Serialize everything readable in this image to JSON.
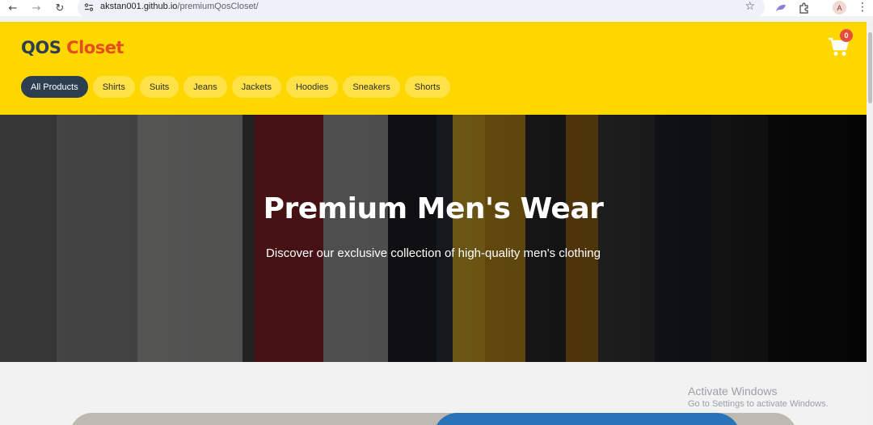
{
  "browser": {
    "url_host": "akstan001.github.io",
    "url_path": "/premiumQosCloset/",
    "profile_initial": "A"
  },
  "header": {
    "logo_part1": "QOS",
    "logo_part2": "Closet",
    "cart_count": "0"
  },
  "categories": [
    {
      "label": "All Products",
      "active": true
    },
    {
      "label": "Shirts"
    },
    {
      "label": "Suits"
    },
    {
      "label": "Jeans"
    },
    {
      "label": "Jackets"
    },
    {
      "label": "Hoodies"
    },
    {
      "label": "Sneakers"
    },
    {
      "label": "Shorts"
    }
  ],
  "hero": {
    "title": "Premium Men's Wear",
    "subtitle": "Discover our exclusive collection of high-quality men's clothing"
  },
  "watermark": {
    "line1": "Activate Windows",
    "line2": "Go to Settings to activate Windows."
  },
  "colors": {
    "header_bg": "#ffd700",
    "logo_dark": "#2c3e50",
    "logo_accent": "#e74c1c",
    "active_pill": "#2c3e50",
    "badge": "#e74c3c"
  }
}
